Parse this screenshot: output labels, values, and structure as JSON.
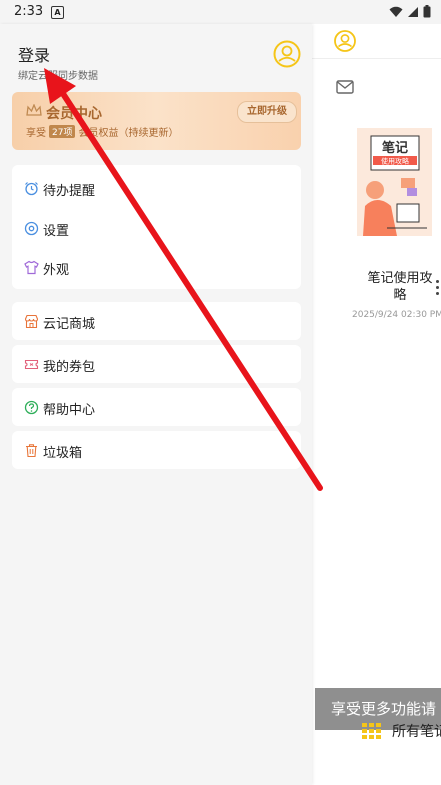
{
  "status": {
    "time": "2:33",
    "notification_letter": "A"
  },
  "drawer": {
    "login": {
      "title": "登录",
      "subtitle": "绑定云服同步数据"
    },
    "vip": {
      "title": "会员中心",
      "sub_prefix": "享受",
      "count": "27项",
      "sub_suffix": "会员权益（持续更新）",
      "upgrade_label": "立即升级"
    },
    "menu_group1": [
      {
        "label": "待办提醒",
        "icon": "alarm-clock-icon"
      },
      {
        "label": "设置",
        "icon": "settings-icon"
      },
      {
        "label": "外观",
        "icon": "shirt-icon"
      }
    ],
    "menu_group2": [
      {
        "label": "云记商城",
        "icon": "store-icon"
      },
      {
        "label": "我的券包",
        "icon": "coupon-icon"
      },
      {
        "label": "帮助中心",
        "icon": "help-icon"
      },
      {
        "label": "垃圾箱",
        "icon": "trash-icon"
      }
    ]
  },
  "right_panel": {
    "note": {
      "title": "笔记使用攻略",
      "date": "2025/9/24 02:30 PM",
      "thumb_text_top": "笔记",
      "thumb_text_sub": "使用攻略"
    },
    "promo_text": "享受更多功能请",
    "all_notes_label": "所有笔记"
  },
  "colors": {
    "accent_yellow": "#f5c518",
    "vip_brown": "#a8672f",
    "arrow_red": "#e8141b"
  }
}
